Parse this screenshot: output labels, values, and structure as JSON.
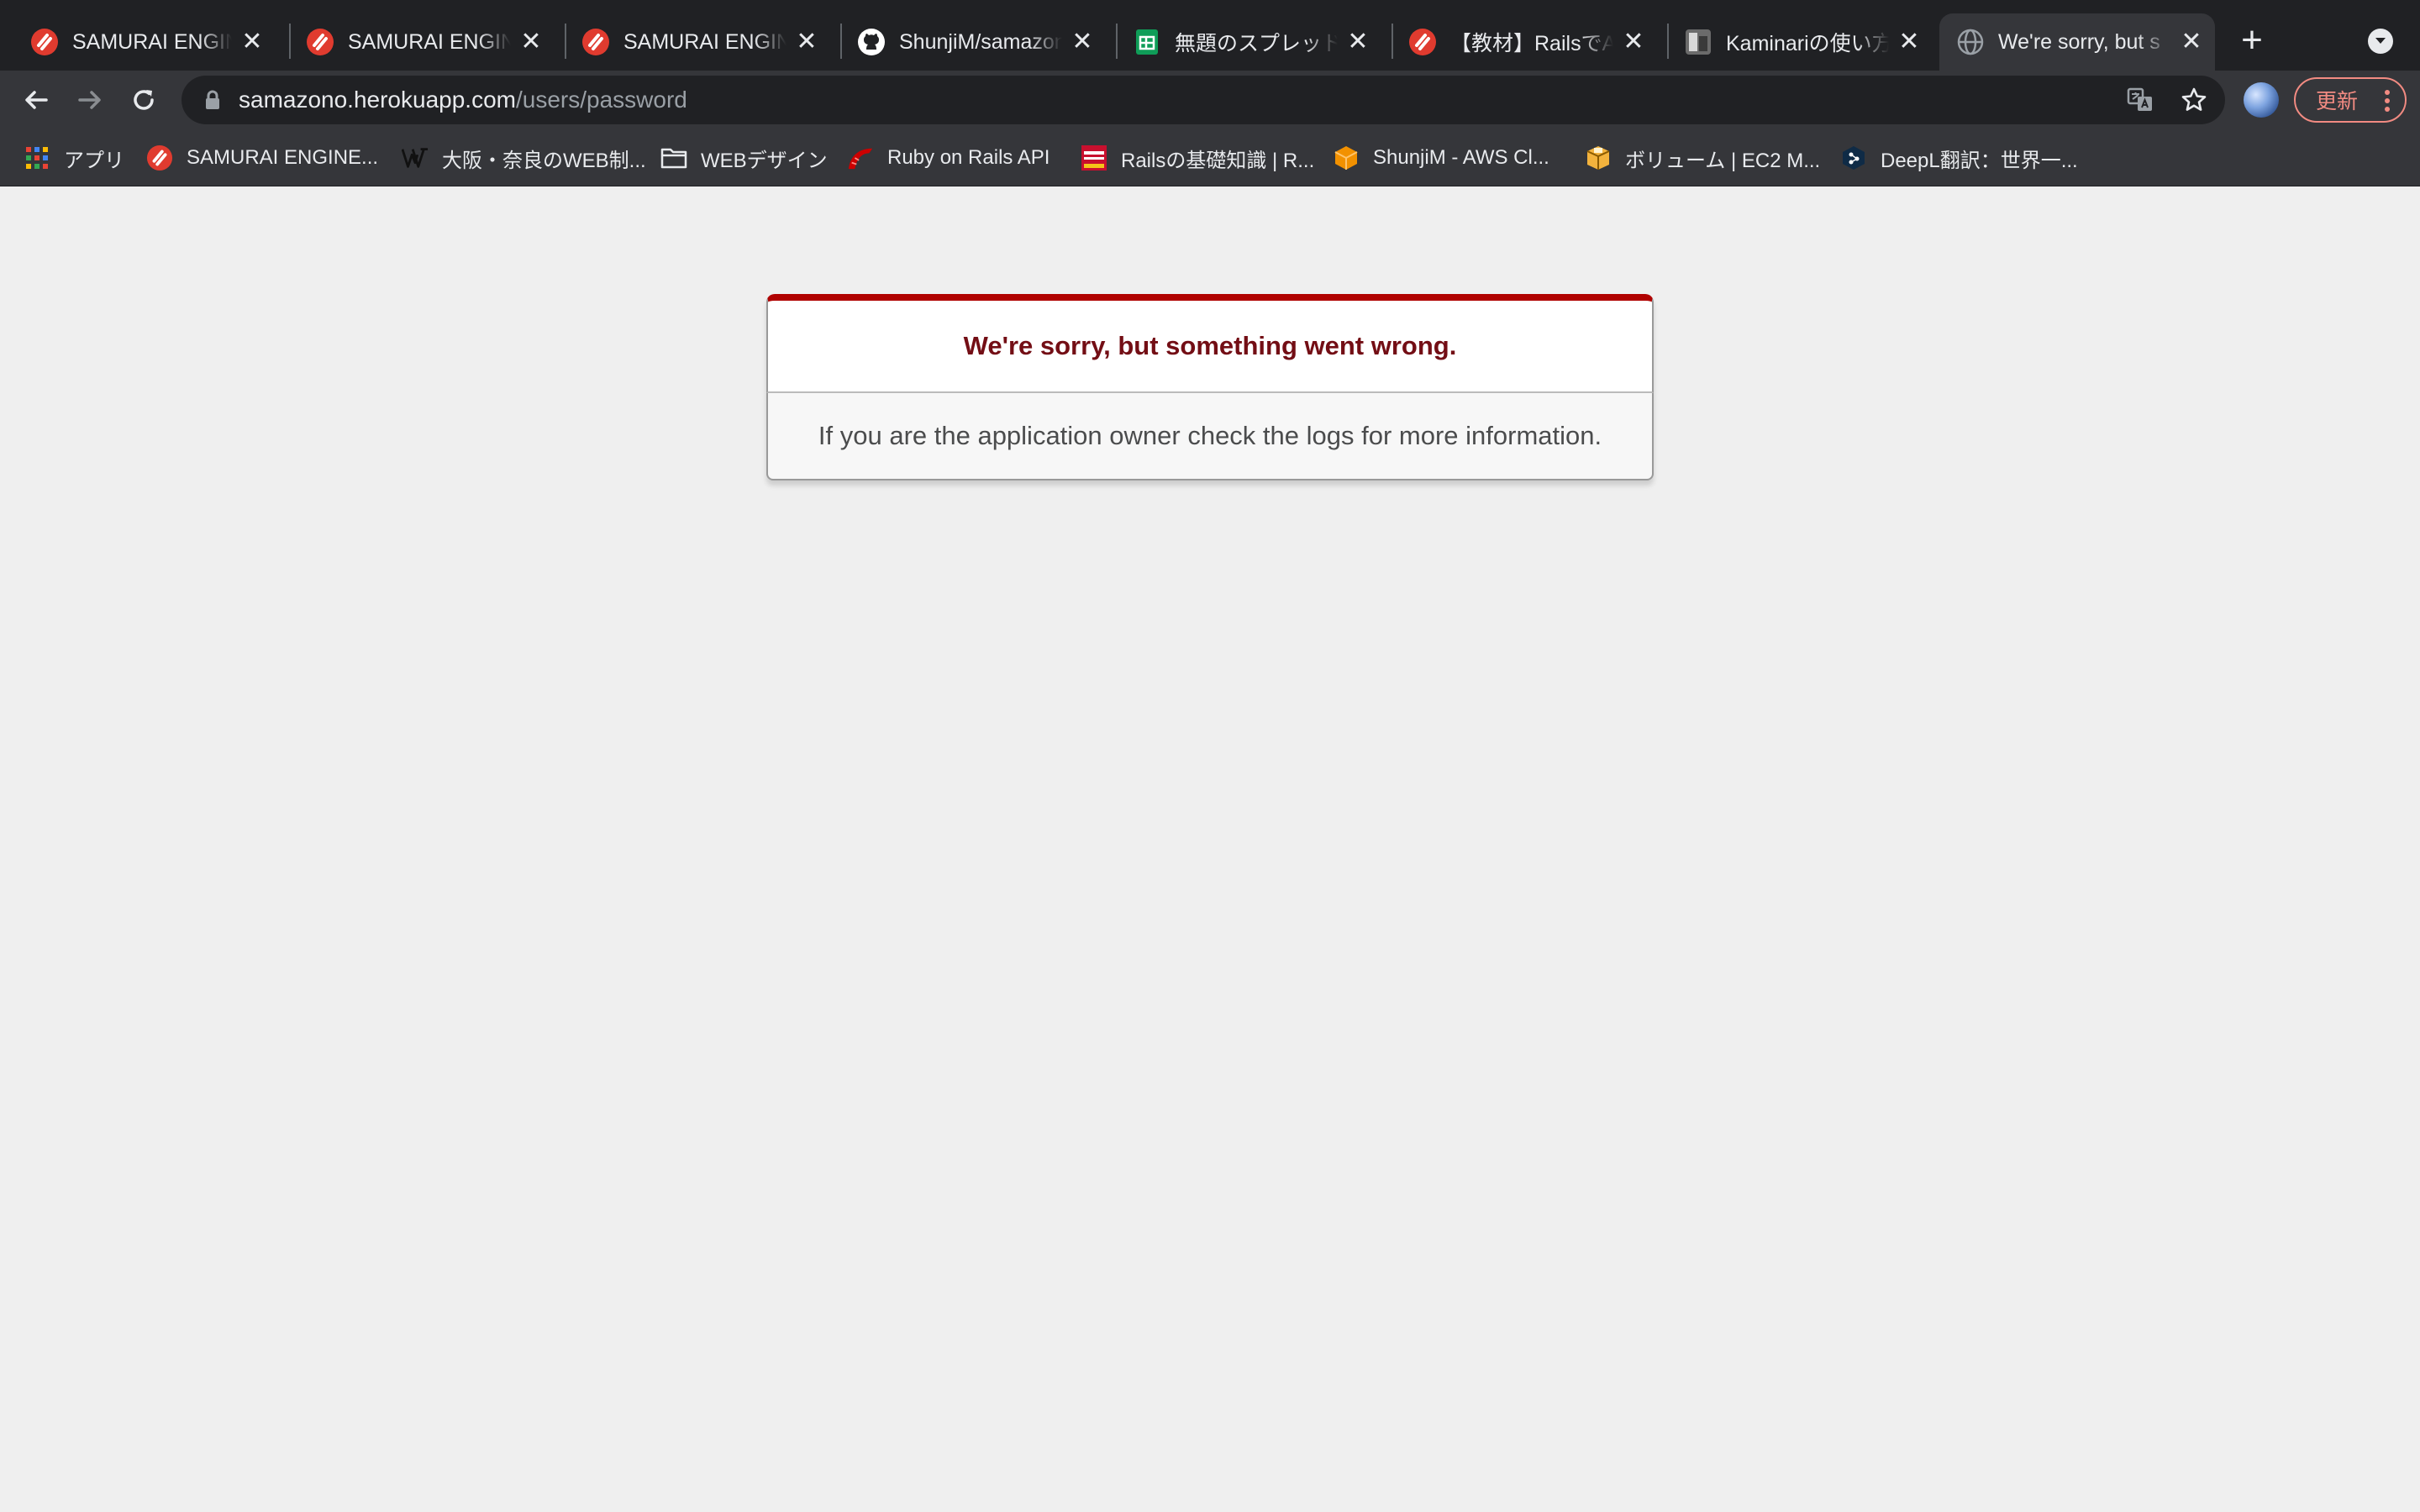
{
  "browser": {
    "tabs": [
      {
        "title": "SAMURAI ENGINE",
        "favicon": "samurai-icon",
        "active": false
      },
      {
        "title": "SAMURAI ENGINE",
        "favicon": "samurai-icon",
        "active": false
      },
      {
        "title": "SAMURAI ENGINE",
        "favicon": "samurai-icon",
        "active": false
      },
      {
        "title": "ShunjiM/samazon",
        "favicon": "github-icon",
        "active": false
      },
      {
        "title": "無題のスプレッドシ",
        "favicon": "sheets-icon",
        "active": false
      },
      {
        "title": "【教材】RailsでAm",
        "favicon": "samurai-icon",
        "active": false
      },
      {
        "title": "Kaminariの使い方",
        "favicon": "kaminari-icon",
        "active": false
      },
      {
        "title": "We're sorry, but s",
        "favicon": "globe-icon",
        "active": true
      }
    ],
    "close_glyph": "✕",
    "new_tab_glyph": "+",
    "url_host": "samazono.herokuapp.com",
    "url_path": "/users/password",
    "update_label": "更新",
    "bookmarks": [
      {
        "label": "アプリ",
        "icon": "apps-grid-icon"
      },
      {
        "label": "SAMURAI ENGINE...",
        "icon": "samurai-icon"
      },
      {
        "label": "大阪・奈良のWEB制...",
        "icon": "w-logo-icon"
      },
      {
        "label": "WEBデザイン",
        "icon": "folder-icon"
      },
      {
        "label": "Ruby on Rails API",
        "icon": "rails-icon"
      },
      {
        "label": "Railsの基礎知識 | R...",
        "icon": "railstutorial-icon"
      },
      {
        "label": "ShunjiM - AWS Cl...",
        "icon": "aws-cube-icon"
      },
      {
        "label": "ボリューム | EC2 M...",
        "icon": "aws-box-icon"
      },
      {
        "label": "DeepL翻訳：世界一...",
        "icon": "deepl-icon"
      }
    ],
    "colors": {
      "accent_red": "#b00100",
      "title_red": "#730e15",
      "update_red": "#f28b82"
    }
  },
  "error_page": {
    "title": "We're sorry, but something went wrong.",
    "message": "If you are the application owner check the logs for more information."
  }
}
